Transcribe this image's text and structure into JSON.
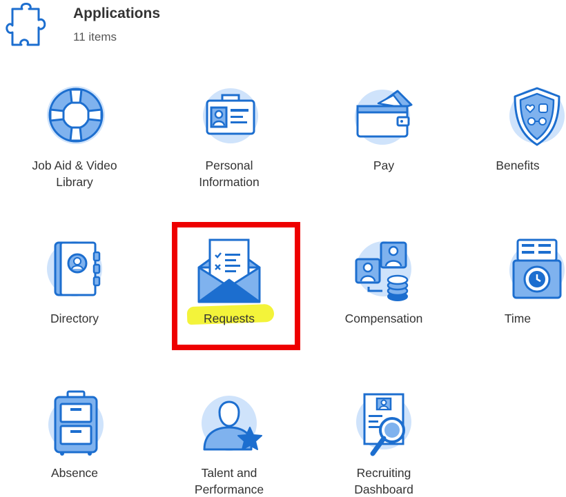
{
  "header": {
    "icon": "puzzle-piece-icon",
    "title": "Applications",
    "count": "11 items"
  },
  "apps": [
    {
      "label": "Job Aid & Video\nLibrary",
      "icon": "lifebuoy-icon"
    },
    {
      "label": "Personal\nInformation",
      "icon": "id-card-icon"
    },
    {
      "label": "Pay",
      "icon": "wallet-icon"
    },
    {
      "label": "Benefits",
      "icon": "shield-icon"
    },
    {
      "label": "Directory",
      "icon": "address-book-icon"
    },
    {
      "label": "Requests",
      "icon": "envelope-letter-icon"
    },
    {
      "label": "Compensation",
      "icon": "people-coins-icon"
    },
    {
      "label": "Time",
      "icon": "time-clock-icon"
    },
    {
      "label": "Absence",
      "icon": "suitcase-icon"
    },
    {
      "label": "Talent and\nPerformance",
      "icon": "person-star-icon"
    },
    {
      "label": "Recruiting\nDashboard",
      "icon": "resume-magnifier-icon"
    }
  ],
  "annotations": {
    "highlighted_app": "Requests",
    "box_color": "#ee0000",
    "highlight_color": "#f3f33a"
  },
  "colors": {
    "icon_blue": "#1c6ecf",
    "icon_light": "#cfe3fb",
    "icon_mid": "#7fb2ee"
  }
}
